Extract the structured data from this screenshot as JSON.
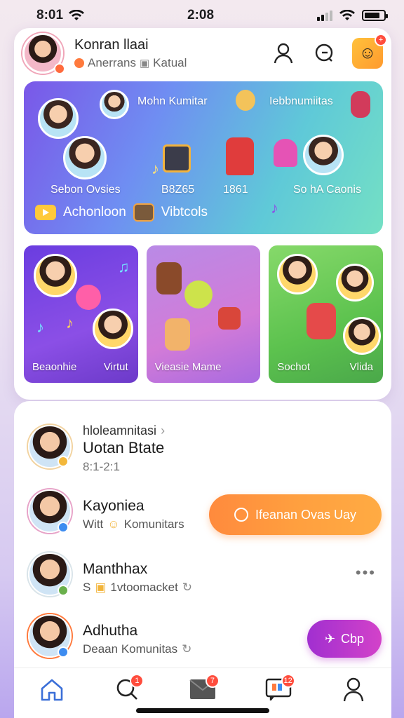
{
  "status_bar": {
    "left_time": "8:01",
    "center_time": "2:08"
  },
  "header": {
    "name": "Konran llaai",
    "subtitle": "Anerrans",
    "subtitle2": "Katual",
    "mascot_badge": "+"
  },
  "banner": {
    "labels": [
      "Mohn Kumitar",
      "Iebbnumiitas",
      "Sebon Ovsies",
      "B8Z65",
      "1861",
      "So hA Caonis"
    ],
    "cta_label": "Achonloon",
    "cta_label2": "Vibtcols"
  },
  "tiles": [
    {
      "label": "Beaonhie",
      "label2": "Virtut"
    },
    {
      "label": "Vieasie Mame"
    },
    {
      "label": "Sochot",
      "label2": "Vlida"
    }
  ],
  "list": [
    {
      "overline": "hloleamnitasi",
      "title": "Uotan Btate",
      "meta": "8:1-2:1"
    },
    {
      "title": "Kayoniea",
      "meta_prefix": "Witt",
      "meta": "Komunitars"
    },
    {
      "title": "Manthhax",
      "meta_prefix": "S",
      "meta": "1vtoomacket"
    },
    {
      "title": "Adhutha",
      "meta": "Deaan Komunitas"
    }
  ],
  "cta_orange": {
    "label": "Ifeanan Ovas Uay"
  },
  "more_menu": "•••",
  "join_button": {
    "label": "Cbp"
  },
  "tabbar": {
    "badges": {
      "search": "1",
      "inbox": "7",
      "activity": "12"
    }
  },
  "colors": {
    "accent_orange": "#ff9a3e",
    "accent_purple": "#b535cf",
    "banner_start": "#7a57e8",
    "banner_end": "#74e0c4"
  },
  "icons": [
    "wifi-icon",
    "signal-icon",
    "battery-icon",
    "profile-icon",
    "chat-search-icon",
    "home-icon",
    "search-icon",
    "mail-icon",
    "activity-icon",
    "user-icon"
  ]
}
